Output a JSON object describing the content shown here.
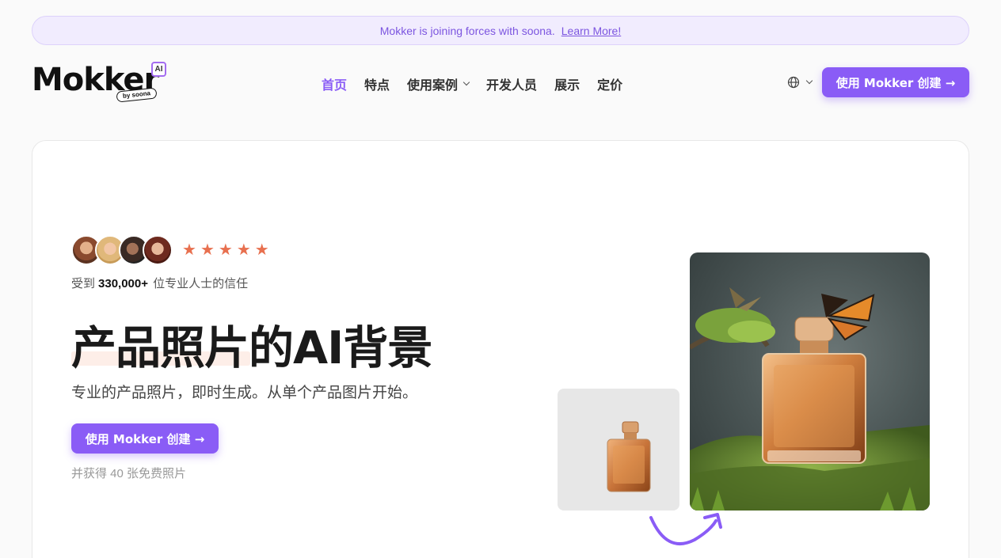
{
  "announcement": {
    "text": "Mokker is joining forces with soona.",
    "link": "Learn More!"
  },
  "logo": {
    "word": "Mokker",
    "badge": "AI",
    "byline": "by soona"
  },
  "nav": {
    "items": [
      "首页",
      "特点",
      "使用案例",
      "开发人员",
      "展示",
      "定价"
    ],
    "active_index": 0
  },
  "header": {
    "language_icon": "globe-icon",
    "cta_label": "使用 Mokker 创建 →"
  },
  "hero": {
    "rating_stars": 5,
    "trust_prefix": "受到",
    "trust_count": "330,000+",
    "trust_suffix": " 位专业人士的信任",
    "headline": "产品照片的AI背景",
    "subtitle": "专业的产品照片，即时生成。从单个产品图片开始。",
    "cta_label": "使用 Mokker 创建 →",
    "free_note": "并获得 40 张免费照片"
  },
  "colors": {
    "accent": "#8a5cf6",
    "star": "#e8704f",
    "announcement_bg": "#f1ecfe"
  }
}
